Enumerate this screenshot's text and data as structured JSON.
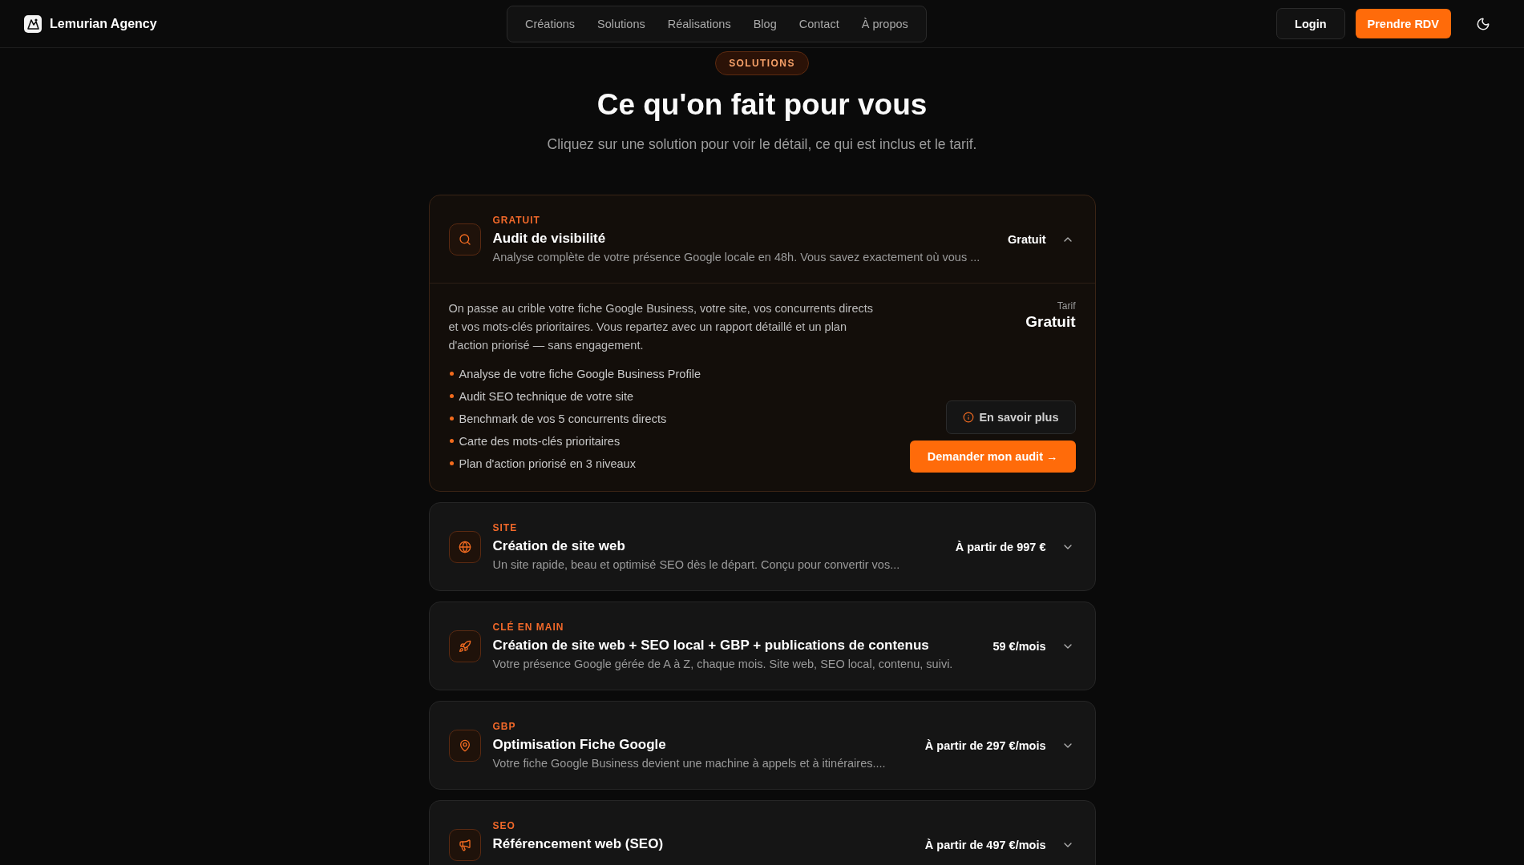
{
  "header": {
    "brand": "Lemurian Agency",
    "nav": [
      "Créations",
      "Solutions",
      "Réalisations",
      "Blog",
      "Contact",
      "À propos"
    ],
    "login": "Login",
    "cta": "Prendre RDV"
  },
  "hero": {
    "badge": "SOLUTIONS",
    "title": "Ce qu'on fait pour vous",
    "subtitle": "Cliquez sur une solution pour voir le détail, ce qui est inclus et le tarif."
  },
  "solutions": [
    {
      "category": "GRATUIT",
      "title": "Audit de visibilité",
      "summary": "Analyse complète de votre présence Google locale en 48h. Vous savez exactement où vous ...",
      "price": "Gratuit",
      "expanded": true,
      "details": {
        "description": "On passe au crible votre fiche Google Business, votre site, vos concurrents directs et vos mots-clés prioritaires. Vous repartez avec un rapport détaillé et un plan d'action priorisé — sans engagement.",
        "features": [
          "Analyse de votre fiche Google Business Profile",
          "Audit SEO technique de votre site",
          "Benchmark de vos 5 concurrents directs",
          "Carte des mots-clés prioritaires",
          "Plan d'action priorisé en 3 niveaux"
        ],
        "price_label": "Tarif",
        "price": "Gratuit",
        "secondary_button": "En savoir plus",
        "primary_button": "Demander mon audit →"
      }
    },
    {
      "category": "SITE",
      "title": "Création de site web",
      "summary": "Un site rapide, beau et optimisé SEO dès le départ. Conçu pour convertir vos...",
      "price": "À partir de 997 €",
      "expanded": false
    },
    {
      "category": "CLÉ EN MAIN",
      "title": "Création de site web + SEO local + GBP + publications de contenus",
      "summary": "Votre présence Google gérée de A à Z, chaque mois. Site web, SEO local, contenu, suivi.",
      "price": "59 €/mois",
      "expanded": false
    },
    {
      "category": "GBP",
      "title": "Optimisation Fiche Google",
      "summary": "Votre fiche Google Business devient une machine à appels et à itinéraires....",
      "price": "À partir de 297 €/mois",
      "expanded": false
    },
    {
      "category": "SEO",
      "title": "Référencement web (SEO)",
      "price": "À partir de 497 €/mois",
      "expanded": false
    }
  ]
}
